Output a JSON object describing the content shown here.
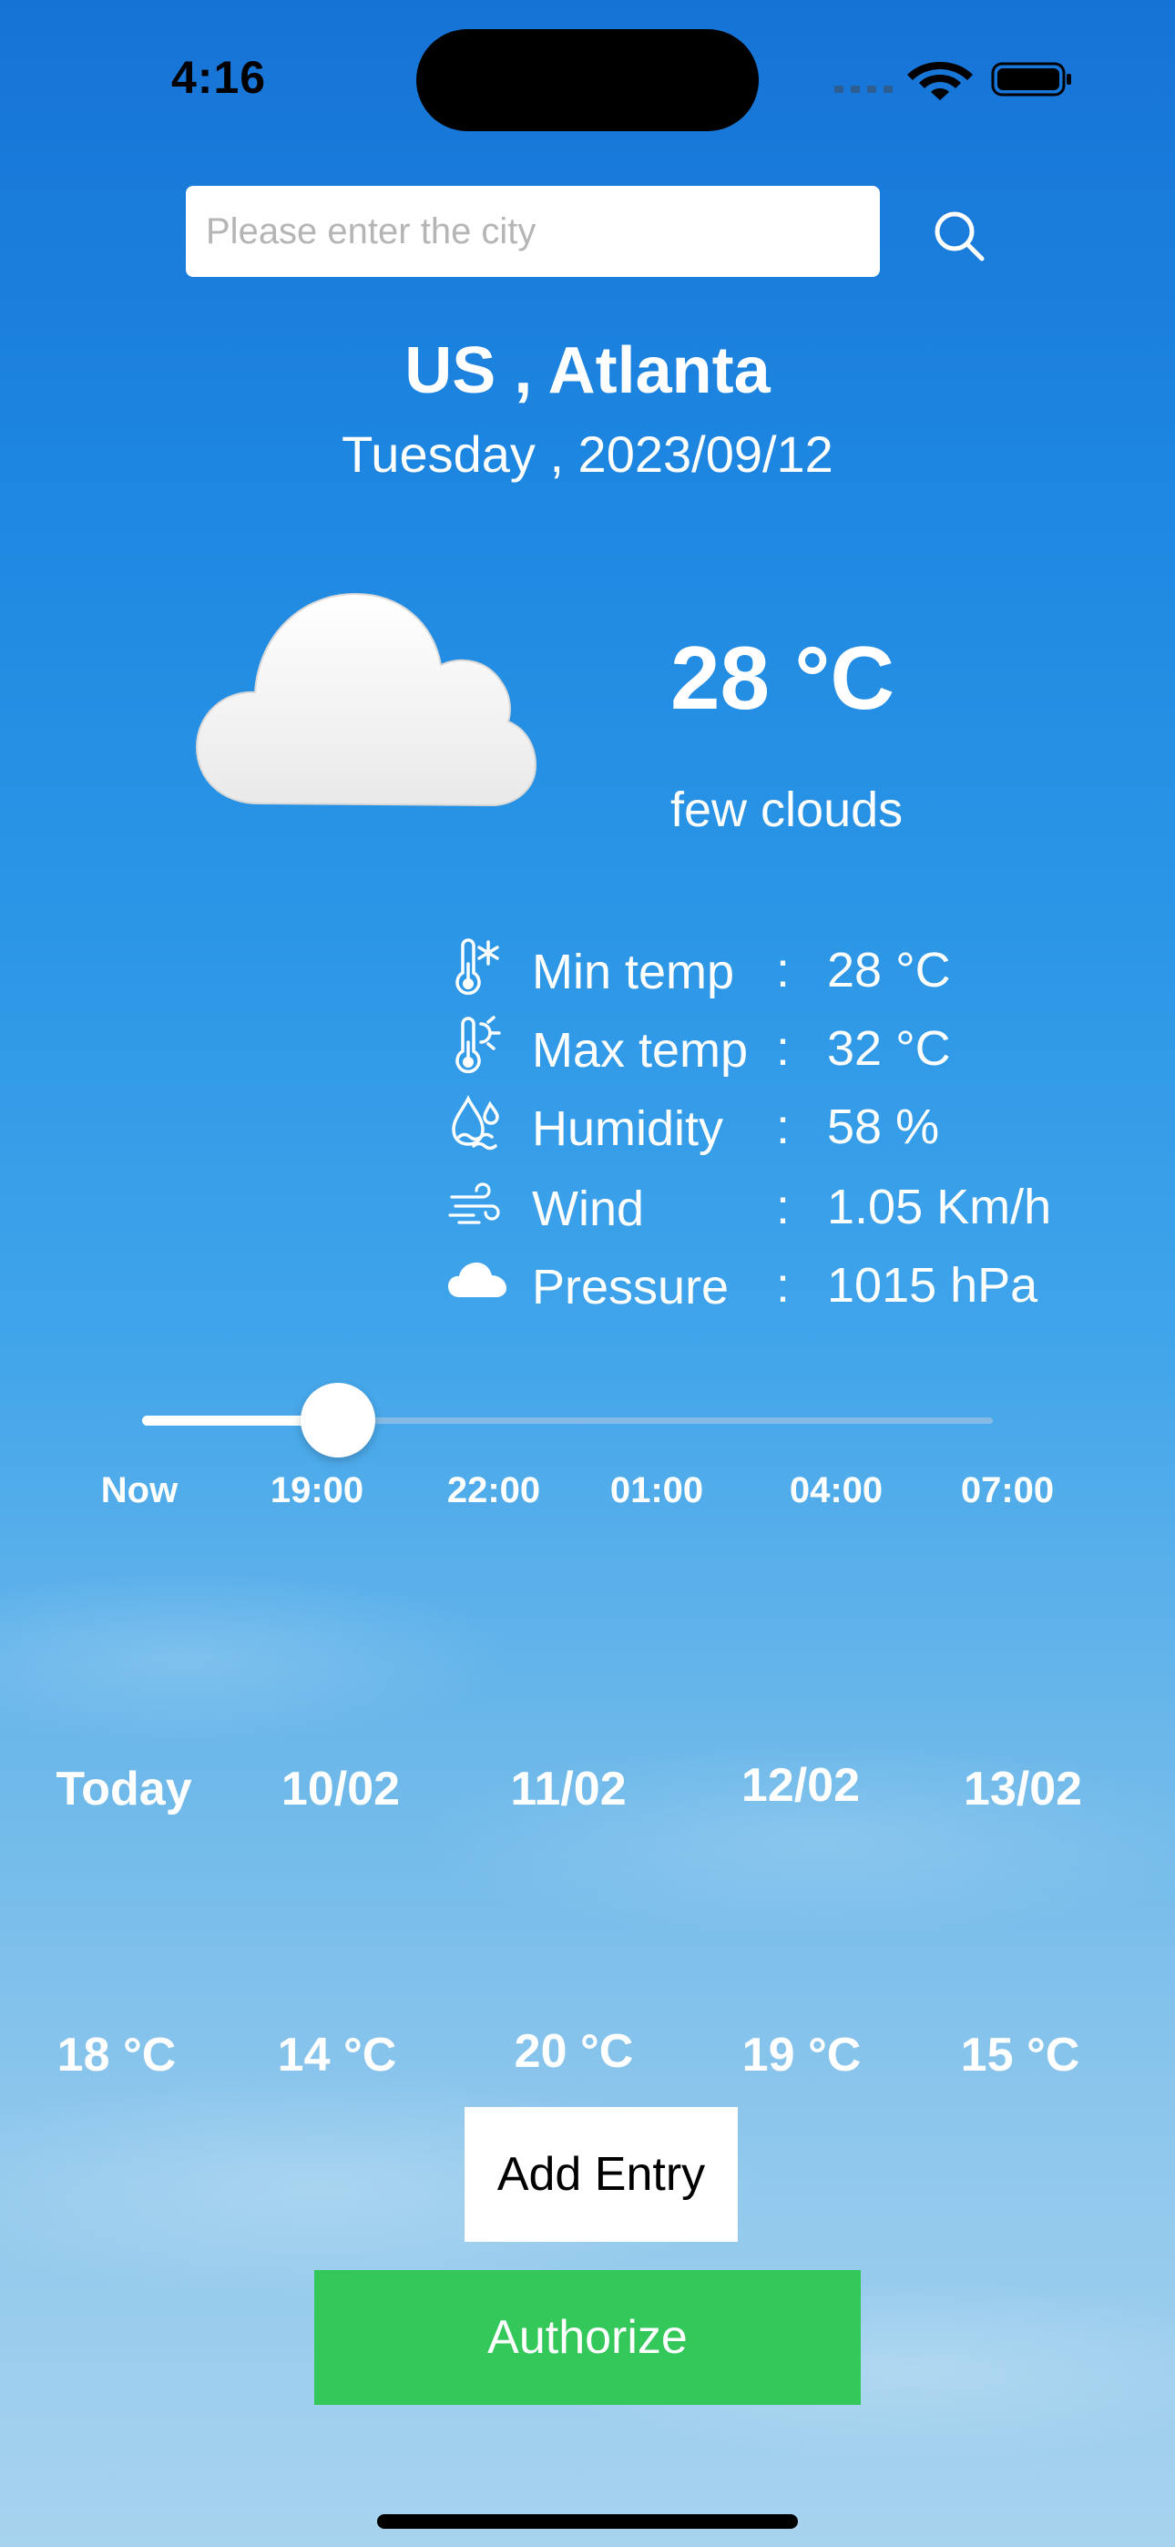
{
  "status_bar": {
    "time": "4:16"
  },
  "search": {
    "placeholder": "Please enter the city",
    "value": "",
    "icon": "search-icon"
  },
  "location": {
    "place": "US , Atlanta",
    "date": "Tuesday , 2023/09/12"
  },
  "current": {
    "icon": "cloud-icon",
    "temperature": "28 °C",
    "description": "few clouds"
  },
  "details": [
    {
      "icon": "thermometer-snow-icon",
      "label": "Min temp",
      "sep": ":",
      "value": "28 °C"
    },
    {
      "icon": "thermometer-sun-icon",
      "label": "Max temp",
      "sep": ":",
      "value": "32 °C"
    },
    {
      "icon": "humidity-icon",
      "label": "Humidity",
      "sep": ":",
      "value": "58 %"
    },
    {
      "icon": "wind-icon",
      "label": "Wind",
      "sep": ":",
      "value": "1.05 Km/h"
    },
    {
      "icon": "cloud-filled-icon",
      "label": "Pressure",
      "sep": ":",
      "value": "1015 hPa"
    }
  ],
  "hourly_slider": {
    "fraction": 0.23,
    "labels": [
      "Now",
      "19:00",
      "22:00",
      "01:00",
      "04:00",
      "07:00"
    ]
  },
  "daily": [
    {
      "day": "Today",
      "temp": "18 °C"
    },
    {
      "day": "10/02",
      "temp": "14 °C"
    },
    {
      "day": "11/02",
      "temp": "20 °C"
    },
    {
      "day": "12/02",
      "temp": "19 °C"
    },
    {
      "day": "13/02",
      "temp": "15 °C"
    }
  ],
  "buttons": {
    "add_entry": "Add Entry",
    "authorize": "Authorize"
  },
  "colors": {
    "sky_top": "#1673d6",
    "sky_bottom": "#a7d3ee",
    "authorize_green": "#34c759"
  }
}
